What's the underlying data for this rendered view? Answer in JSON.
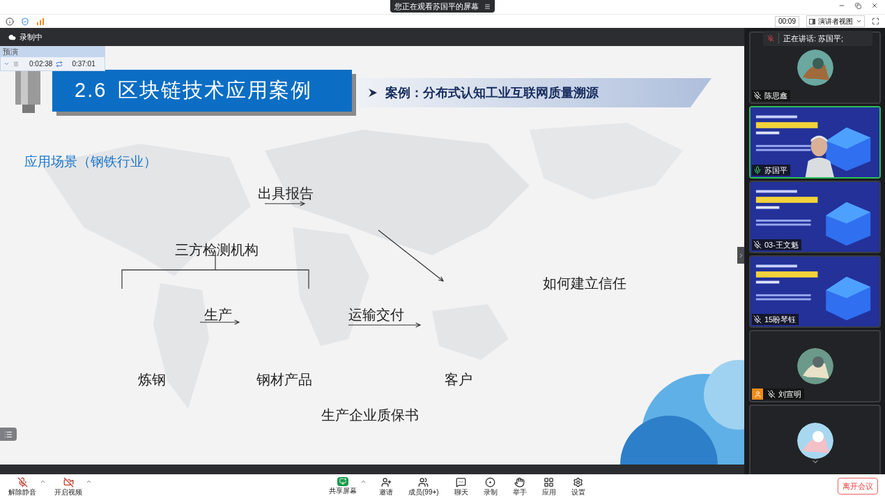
{
  "top_bar": {
    "viewing_banner": "您正在观看苏国平的屏幕",
    "timer": "00:09",
    "view_mode": "演讲者视图"
  },
  "recording": {
    "label": "录制中"
  },
  "rehearsal": {
    "title": "预演",
    "elapsed": "0:02:38",
    "total": "0:37:01"
  },
  "slide": {
    "title_number": "2.6",
    "title": "区块链技术应用案例",
    "subtitle": "案例：分布式认知工业互联网质量溯源",
    "scene_label": "应用场景（钢铁行业）",
    "diagram_labels": [
      {
        "text": "出具报告"
      },
      {
        "text": "三方检测机构"
      },
      {
        "text": "生产"
      },
      {
        "text": "运输交付"
      },
      {
        "text": "如何建立信任"
      },
      {
        "text": "炼钢"
      },
      {
        "text": "钢材产品"
      },
      {
        "text": "客户"
      },
      {
        "text": "生产企业质保书"
      }
    ]
  },
  "speaker_bar": {
    "label": "正在讲话: 苏国平;"
  },
  "participants": [
    {
      "name": "陈思鑫",
      "kind": "avatar",
      "muted": true,
      "speaking": false,
      "host": false
    },
    {
      "name": "苏国平",
      "kind": "video",
      "muted": false,
      "speaking": true,
      "host": false
    },
    {
      "name": "03-王文魁",
      "kind": "slide",
      "muted": true,
      "speaking": false,
      "host": false
    },
    {
      "name": "15盼琴钰",
      "kind": "slide",
      "muted": true,
      "speaking": false,
      "host": false
    },
    {
      "name": "刘宣明",
      "kind": "avatar",
      "muted": true,
      "speaking": false,
      "host": true
    },
    {
      "kind": "avatar",
      "speaking": false
    }
  ],
  "toolbar": {
    "left": [
      {
        "label": "解除静音",
        "kind": "mic"
      },
      {
        "label": "开启视频",
        "kind": "video"
      }
    ],
    "center": [
      {
        "label": "共享屏幕",
        "kind": "share"
      },
      {
        "label": "邀请",
        "kind": "invite"
      },
      {
        "label": "成员(99+)",
        "kind": "members"
      },
      {
        "label": "聊天",
        "kind": "chat"
      },
      {
        "label": "录制",
        "kind": "record"
      },
      {
        "label": "举手",
        "kind": "hand"
      },
      {
        "label": "应用",
        "kind": "apps"
      },
      {
        "label": "设置",
        "kind": "settings"
      }
    ],
    "leave": "离开会议"
  }
}
